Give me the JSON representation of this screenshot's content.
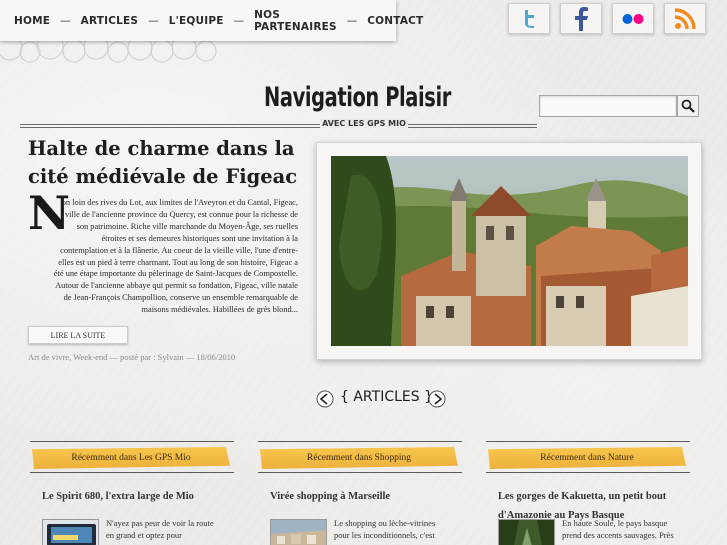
{
  "nav": {
    "items": [
      "HOME",
      "ARTICLES",
      "L'EQUIPE",
      "NOS PARTENAIRES",
      "CONTACT"
    ],
    "separator": "—"
  },
  "social": [
    {
      "name": "twitter-icon",
      "color": "#4ca9d6"
    },
    {
      "name": "facebook-icon",
      "color": "#3b5998"
    },
    {
      "name": "flickr-icon",
      "color": "#0063dc"
    },
    {
      "name": "rss-icon",
      "color": "#f58b1e"
    }
  ],
  "header": {
    "logo": "Navigation Plaisir",
    "tagline": "AVEC LES GPS MIO"
  },
  "search": {
    "placeholder": "",
    "value": ""
  },
  "featured": {
    "title": "Halte de charme dans la cité médiévale de Figeac",
    "dropcap": "N",
    "body": "on loin des rives du Lot, aux limites de l'Aveyron et du Cantal, Figeac, ville de l'ancienne province du Quercy, est connue pour la richesse de son patrimoine. Riche ville marchande du Moyen-Âge, ses ruelles étroites et ses demeures historiques sont une invitation à la contemplation et à la flânerie. Au coeur de la vieille ville, l'une d'entre-elles est un pied à terre charmant. Tout au long de son histoire, Figeac a été une étape importante du pèlerinage de Saint-Jacques de Compostelle. Autour de l'ancienne abbaye qui permit sa fondation, Figeac, ville natale de Jean-François Champollion, conserve un ensemble remarquable de maisons médiévales. Habillées de grès blond...",
    "read_more": "LIRE LA SUITE",
    "meta": "Art de vivre, Week-end — posté par : Sylvain — 18/06/2010"
  },
  "carousel": {
    "prev": "<",
    "next": ">",
    "label": "{ ARTICLES }"
  },
  "columns": [
    {
      "header": "Récemment dans Les GPS Mio",
      "title": "Le Spirit 680, l'extra large de Mio",
      "excerpt": "N'ayez pas peur de voir la route en grand et optez pour"
    },
    {
      "header": "Récemment dans Shopping",
      "title": "Virée shopping à Marseille",
      "excerpt": "Le shopping ou lèche-vitrines pour les inconditionnels, c'est"
    },
    {
      "header": "Récemment dans Nature",
      "title": "Les gorges de Kakuetta, un petit bout d'Amazonie au Pays Basque",
      "excerpt": "En haute Soule, le pays basque prend des accents sauvages. Près"
    }
  ]
}
